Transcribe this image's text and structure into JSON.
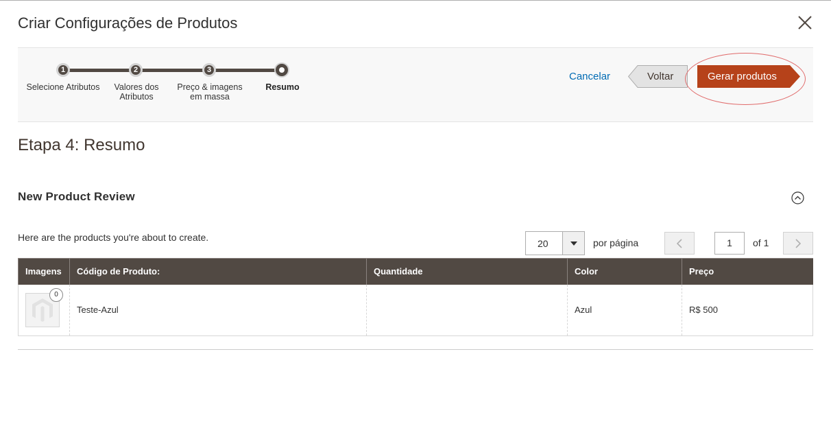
{
  "modal": {
    "title": "Criar Configurações de Produtos"
  },
  "steps": [
    {
      "number": "1",
      "label": "Selecione Atributos"
    },
    {
      "number": "2",
      "label": "Valores dos Atributos"
    },
    {
      "number": "3",
      "label": "Preço & imagens em massa"
    },
    {
      "number": "",
      "label": "Resumo"
    }
  ],
  "actions": {
    "cancel": "Cancelar",
    "back": "Voltar",
    "generate": "Gerar produtos"
  },
  "page": {
    "heading": "Etapa 4: Resumo",
    "section_title": "New Product Review",
    "intro": "Here are the products you're about to create."
  },
  "pager": {
    "per_page_value": "20",
    "per_page_label": "por página",
    "current_page": "1",
    "of_pages": "of 1"
  },
  "table": {
    "columns": [
      "Imagens",
      "Código de Produto:",
      "Quantidade",
      "Color",
      "Preço"
    ],
    "rows": [
      {
        "image_count": "0",
        "sku": "Teste-Azul",
        "quantity": "",
        "color": "Azul",
        "price": "R$ 500"
      }
    ]
  },
  "colors": {
    "header_bg": "#514943",
    "primary_button": "#b6421a",
    "link": "#006bb4",
    "highlight": "#e06a6a"
  },
  "icons": {
    "close": "close-icon",
    "collapse": "chevron-up-circle-icon",
    "dropdown": "caret-down-icon",
    "prev": "chevron-left-icon",
    "next": "chevron-right-icon",
    "placeholder": "magento-logo-icon"
  }
}
